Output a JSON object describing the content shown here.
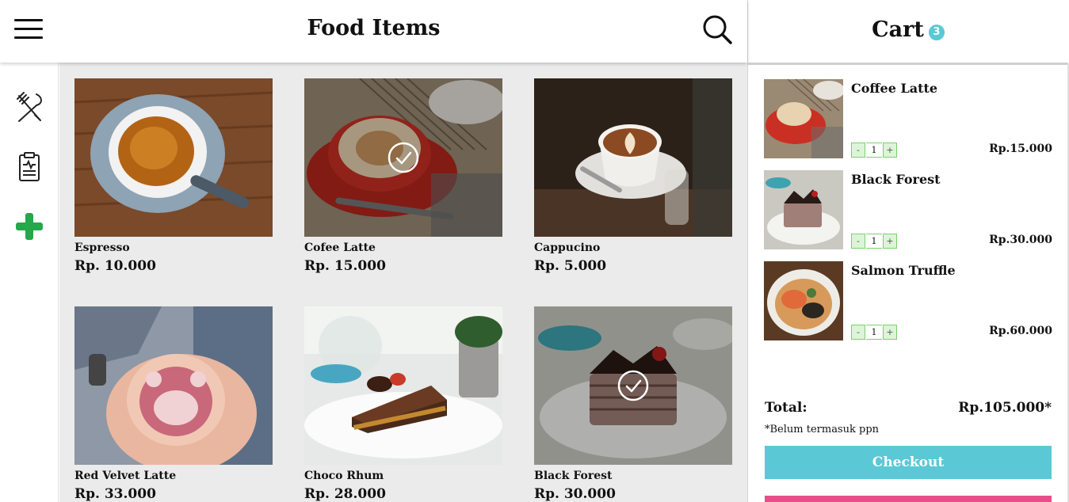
{
  "header": {
    "title": "Food Items"
  },
  "sidebar": {
    "items": [
      {
        "icon": "fork-knife-icon"
      },
      {
        "icon": "clipboard-icon"
      },
      {
        "icon": "plus-icon",
        "color": "#23a84a"
      }
    ]
  },
  "menu": {
    "items": [
      {
        "name": "Espresso",
        "price": "Rp. 10.000",
        "selected": false
      },
      {
        "name": "Cofee Latte",
        "price": "Rp. 15.000",
        "selected": true
      },
      {
        "name": "Cappucino",
        "price": "Rp. 5.000",
        "selected": false
      },
      {
        "name": "Red Velvet Latte",
        "price": "Rp. 33.000",
        "selected": false
      },
      {
        "name": "Choco Rhum",
        "price": "Rp. 28.000",
        "selected": false
      },
      {
        "name": "Black Forest",
        "price": "Rp. 30.000",
        "selected": true
      }
    ]
  },
  "cart": {
    "title": "Cart",
    "count": "3",
    "items": [
      {
        "name": "Coffee Latte",
        "qty": "1",
        "price": "Rp.15.000"
      },
      {
        "name": "Black Forest",
        "qty": "1",
        "price": "Rp.30.000"
      },
      {
        "name": "Salmon Truffle",
        "qty": "1",
        "price": "Rp.60.000"
      }
    ],
    "stepper": {
      "minus": "-",
      "plus": "+"
    },
    "total_label": "Total:",
    "total_value": "Rp.105.000*",
    "note": "*Belum termasuk ppn",
    "checkout_label": "Checkout"
  },
  "colors": {
    "accent": "#5bc8d6",
    "cancel": "#e84f8a",
    "add": "#23a84a",
    "stepper": "#dcf5d6"
  }
}
